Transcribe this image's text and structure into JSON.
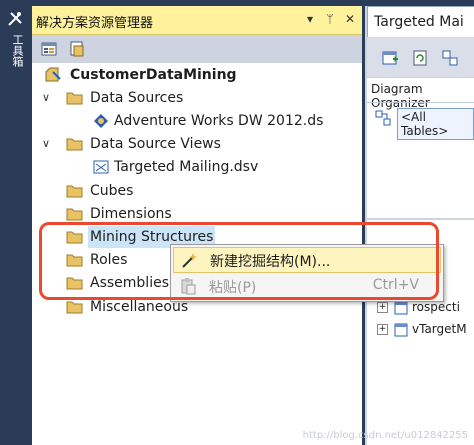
{
  "toolbox": {
    "label": "工具箱"
  },
  "solution_explorer": {
    "title": "解决方案资源管理器",
    "title_buttons": [
      "▾",
      "ᛘ",
      "✕"
    ],
    "tree": [
      {
        "id": "root",
        "label": "CustomerDataMining",
        "icon": "project-icon",
        "bold": true
      },
      {
        "id": "data-sources",
        "label": "Data Sources",
        "icon": "folder-icon",
        "expanded": true
      },
      {
        "id": "dsrc-item",
        "label": "Adventure Works DW 2012.ds",
        "icon": "datasource-icon"
      },
      {
        "id": "dsv",
        "label": "Data Source Views",
        "icon": "folder-icon",
        "expanded": true
      },
      {
        "id": "dsv-item",
        "label": "Targeted Mailing.dsv",
        "icon": "dsv-icon"
      },
      {
        "id": "cubes",
        "label": "Cubes",
        "icon": "folder-icon"
      },
      {
        "id": "dimensions",
        "label": "Dimensions",
        "icon": "folder-icon"
      },
      {
        "id": "mining",
        "label": "Mining Structures",
        "icon": "folder-icon",
        "selected": true
      },
      {
        "id": "roles",
        "label": "Roles",
        "icon": "folder-icon"
      },
      {
        "id": "assemblies",
        "label": "Assemblies",
        "icon": "folder-icon"
      },
      {
        "id": "misc",
        "label": "Miscellaneous",
        "icon": "folder-icon"
      }
    ]
  },
  "designer": {
    "tab_title": "Targeted Mai",
    "organizer_title": "Diagram Organizer",
    "organizer_item": "<All Tables>",
    "lower_items": [
      "rospecti",
      "vTargetM"
    ]
  },
  "context_menu": {
    "items": [
      {
        "label": "新建挖掘结构(M)...",
        "shortcut": "",
        "icon": "wand-icon",
        "highlighted": true,
        "enabled": true
      },
      {
        "label": "粘贴(P)",
        "shortcut": "Ctrl+V",
        "icon": "paste-icon",
        "highlighted": false,
        "enabled": false
      }
    ]
  },
  "watermark": "http://blog.csdn.net/u012842255",
  "colors": {
    "background": "#2b3c59",
    "title_active": "#fff29d",
    "menu_highlight": "#fdf4bf",
    "annotation": "#e84a2f",
    "folder": "#e9c266"
  }
}
